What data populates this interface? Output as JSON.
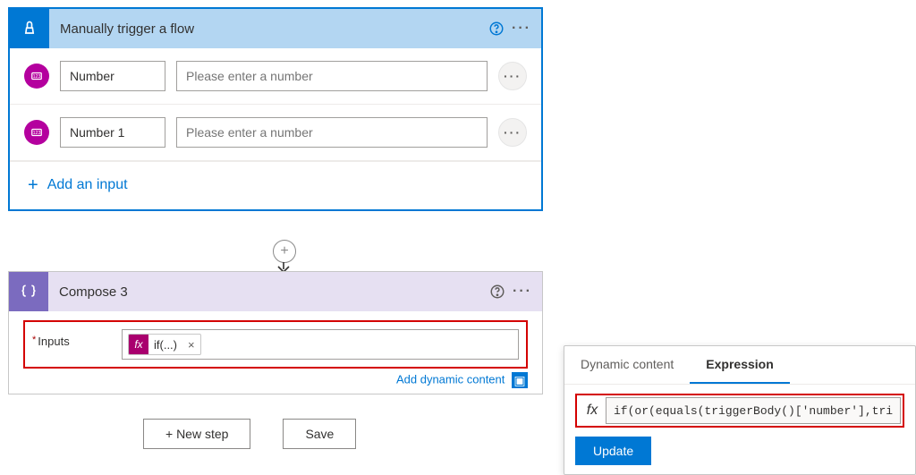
{
  "trigger": {
    "title": "Manually trigger a flow",
    "params": [
      {
        "name": "Number",
        "placeholder": "Please enter a number"
      },
      {
        "name": "Number 1",
        "placeholder": "Please enter a number"
      }
    ],
    "addInputLabel": "Add an input"
  },
  "compose": {
    "title": "Compose 3",
    "inputsLabel": "Inputs",
    "token": {
      "fx": "fx",
      "label": "if(...)",
      "x": "×"
    },
    "addDynamic": "Add dynamic content"
  },
  "footer": {
    "newStep": "+ New step",
    "save": "Save"
  },
  "expr": {
    "tabDyn": "Dynamic content",
    "tabExpr": "Expression",
    "fx": "fx",
    "value": "if(or(equals(triggerBody()['number'],trigg",
    "update": "Update"
  }
}
